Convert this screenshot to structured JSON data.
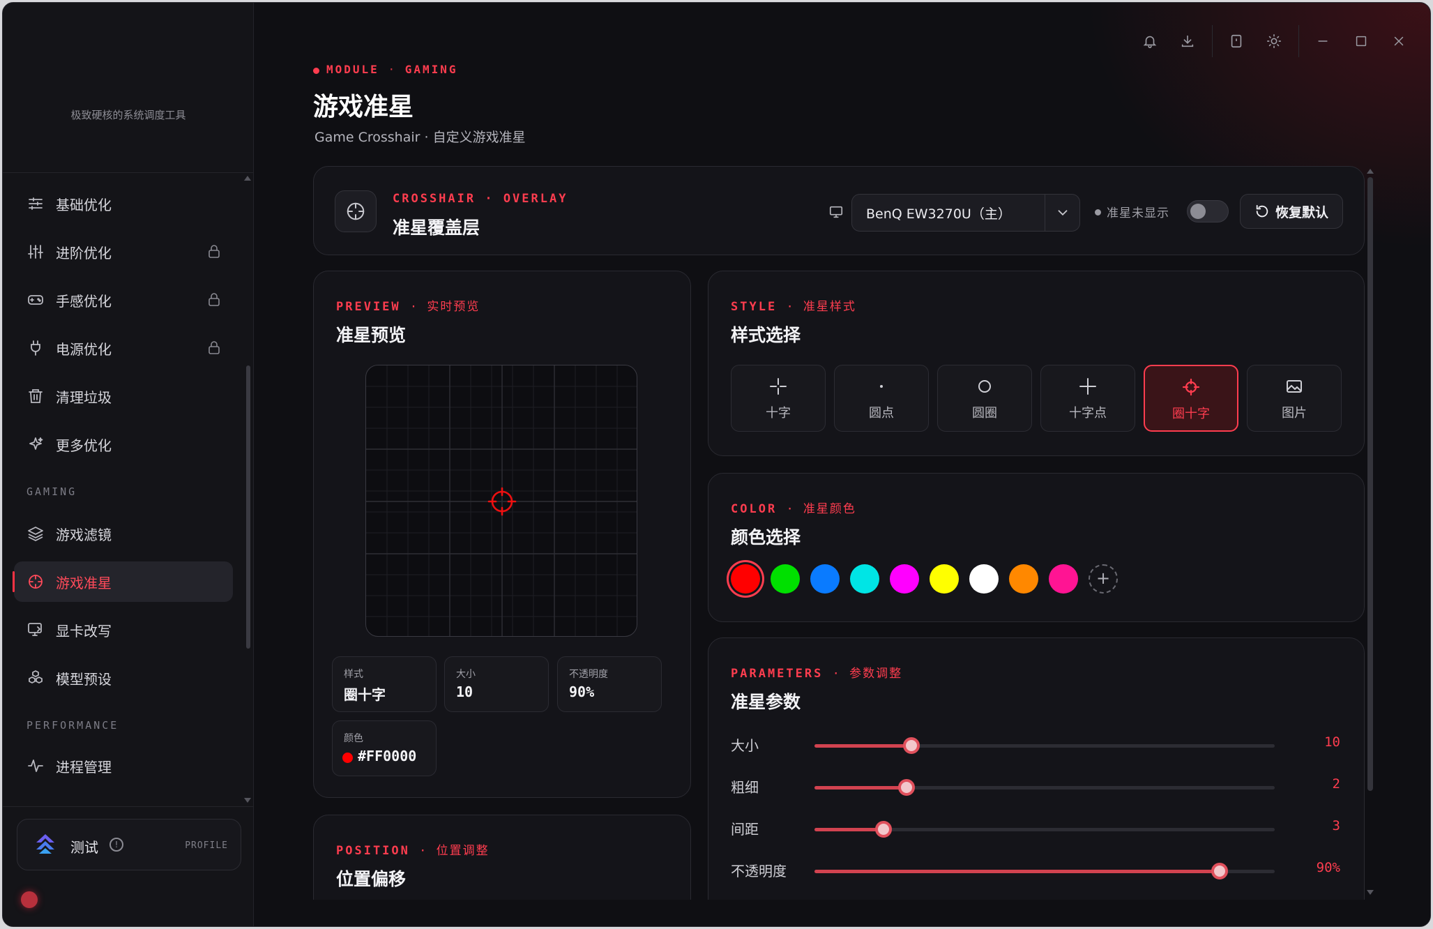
{
  "sidebar": {
    "tagline": "极致硬核的系统调度工具",
    "items": [
      {
        "label": "基础优化",
        "icon": "sliders-icon",
        "locked": false
      },
      {
        "label": "进阶优化",
        "icon": "equalizer-icon",
        "locked": true
      },
      {
        "label": "手感优化",
        "icon": "gamepad-icon",
        "locked": true
      },
      {
        "label": "电源优化",
        "icon": "plug-icon",
        "locked": true
      },
      {
        "label": "清理垃圾",
        "icon": "trash-icon",
        "locked": false
      },
      {
        "label": "更多优化",
        "icon": "sparkle-icon",
        "locked": false
      }
    ],
    "section_gaming": "GAMING",
    "gaming_items": [
      {
        "label": "游戏滤镜",
        "icon": "layers-icon"
      },
      {
        "label": "游戏准星",
        "icon": "crosshair-icon",
        "active": true
      },
      {
        "label": "显卡改写",
        "icon": "monitor-edit-icon"
      },
      {
        "label": "模型预设",
        "icon": "cubes-icon"
      }
    ],
    "section_performance": "PERFORMANCE",
    "performance_items": [
      {
        "label": "进程管理",
        "icon": "activity-icon"
      }
    ],
    "profile": {
      "name": "测试",
      "tag": "PROFILE"
    }
  },
  "header": {
    "eyebrow_a": "MODULE",
    "eyebrow_sep": "·",
    "eyebrow_b": "GAMING",
    "title": "游戏准星",
    "subtitle": "Game Crosshair · 自定义游戏准星"
  },
  "overlay": {
    "eyebrow": "CROSSHAIR · OVERLAY",
    "title": "准星覆盖层",
    "monitor": "BenQ EW3270U（主）",
    "status": "准星未显示",
    "reset_label": "恢复默认"
  },
  "preview": {
    "eyebrow_en": "PREVIEW",
    "eyebrow_cn": "实时预览",
    "title": "准星预览",
    "stats": {
      "style_k": "样式",
      "style_v": "圈十字",
      "size_k": "大小",
      "size_v": "10",
      "opacity_k": "不透明度",
      "opacity_v": "90%",
      "color_k": "颜色",
      "color_v": "#FF0000"
    }
  },
  "position": {
    "eyebrow_en": "POSITION",
    "eyebrow_cn": "位置调整",
    "title": "位置偏移"
  },
  "style": {
    "eyebrow_en": "STYLE",
    "eyebrow_cn": "准星样式",
    "title": "样式选择",
    "options": [
      "十字",
      "圆点",
      "圆圈",
      "十字点",
      "圈十字",
      "图片"
    ],
    "selected": "圈十字"
  },
  "color": {
    "eyebrow_en": "COLOR",
    "eyebrow_cn": "准星颜色",
    "title": "颜色选择",
    "swatches": [
      "#FF0000",
      "#00E000",
      "#0A7BFF",
      "#00E5E5",
      "#FF00FF",
      "#FFFF00",
      "#FFFFFF",
      "#FF8800",
      "#FF1493"
    ],
    "selected": "#FF0000",
    "add_symbol": "+"
  },
  "params": {
    "eyebrow_en": "PARAMETERS",
    "eyebrow_cn": "参数调整",
    "title": "准星参数",
    "items": [
      {
        "label": "大小",
        "value": "10",
        "fraction": 0.21
      },
      {
        "label": "粗细",
        "value": "2",
        "fraction": 0.2
      },
      {
        "label": "间距",
        "value": "3",
        "fraction": 0.15
      },
      {
        "label": "不透明度",
        "value": "90%",
        "fraction": 0.88
      }
    ]
  },
  "colors": {
    "accent": "#FF3D4F",
    "bg": "#0F0F13",
    "card": "#141419"
  }
}
